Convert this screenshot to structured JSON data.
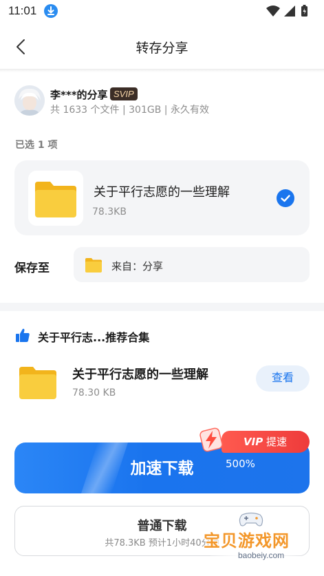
{
  "status_bar": {
    "time": "11:01"
  },
  "nav": {
    "title": "转存分享"
  },
  "sharer": {
    "name": "李***的分享",
    "badge": "SVIP",
    "meta": "共 1633 个文件 | 301GB | 永久有效"
  },
  "selection": {
    "count_label": "已选 1 项"
  },
  "selected_file": {
    "name": "关于平行志愿的一些理解",
    "size": "78.3KB",
    "checked": true
  },
  "save_to": {
    "label": "保存至",
    "value": "来自：分享"
  },
  "recommend": {
    "title": "关于平行志...推荐合集",
    "item": {
      "name": "关于平行志愿的一些理解",
      "size": "78.30 KB",
      "view_label": "查看"
    }
  },
  "fast_download": {
    "label": "加速下载",
    "tag_vip": "VIP",
    "tag_text": "提速500%"
  },
  "normal_download": {
    "label": "普通下载",
    "sub": "共78.3KB  预计1小时40分钟"
  },
  "watermark": {
    "text": "宝贝游戏网",
    "domain": "baobeiy.com"
  },
  "colors": {
    "accent": "#1a75ee",
    "vip_red": "#ee3b3b",
    "svip_bg": "#3b2d26",
    "folder": "#f7c638"
  }
}
